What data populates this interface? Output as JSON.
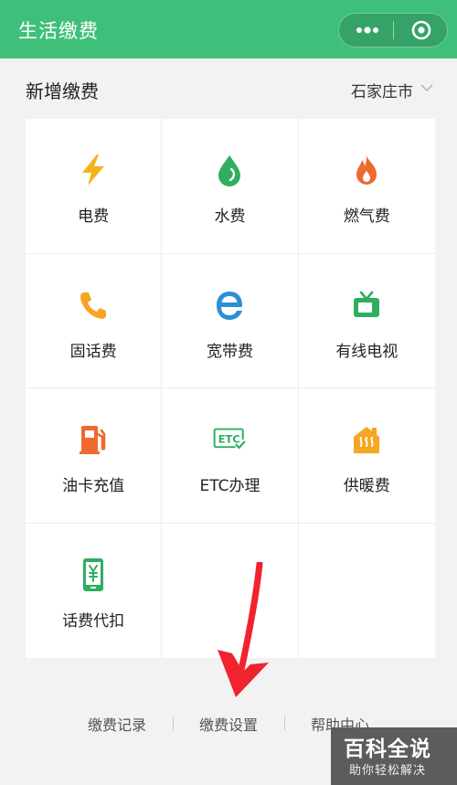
{
  "app_bar": {
    "title": "生活缴费",
    "more_icon": "more-dots-icon",
    "close_icon": "target-close-icon",
    "color": "#3fc07a"
  },
  "header": {
    "section_title": "新增缴费",
    "city": "石家庄市"
  },
  "services": [
    {
      "label": "电费",
      "icon": "lightning-icon",
      "color": "#f5b21b"
    },
    {
      "label": "水费",
      "icon": "water-drop-icon",
      "color": "#2fae5f"
    },
    {
      "label": "燃气费",
      "icon": "flame-icon",
      "color": "#ee6a2f"
    },
    {
      "label": "固话费",
      "icon": "phone-icon",
      "color": "#f5a623"
    },
    {
      "label": "宽带费",
      "icon": "ie-icon",
      "color": "#2b8fd6"
    },
    {
      "label": "有线电视",
      "icon": "tv-icon",
      "color": "#2fae5f"
    },
    {
      "label": "油卡充值",
      "icon": "fuel-pump-icon",
      "color": "#ee6a2f"
    },
    {
      "label": "ETC办理",
      "icon": "etc-icon",
      "color": "#2fae5f"
    },
    {
      "label": "供暖费",
      "icon": "heating-house-icon",
      "color": "#f5a623"
    },
    {
      "label": "话费代扣",
      "icon": "mobile-yuan-icon",
      "color": "#2fae5f"
    }
  ],
  "footer": {
    "links": [
      "缴费记录",
      "缴费设置",
      "帮助中心"
    ]
  },
  "watermark": {
    "main": "百科全说",
    "sub": "助你轻松解决"
  },
  "annotation_arrow_color": "#f0232e"
}
